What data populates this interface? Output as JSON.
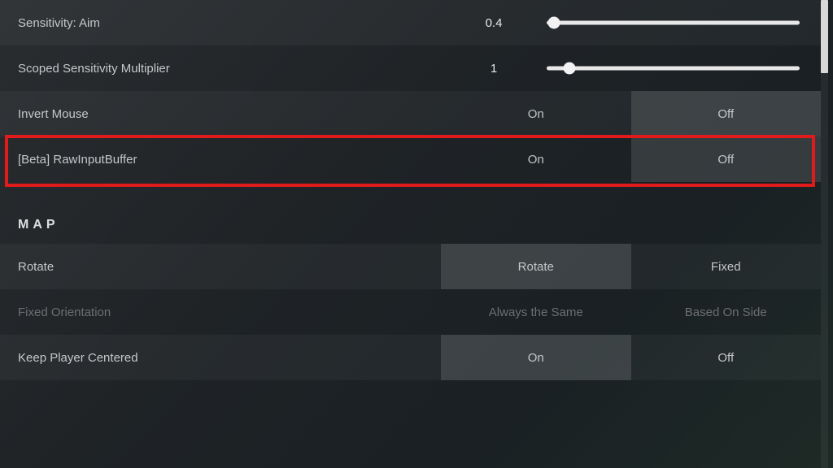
{
  "sensitivity": {
    "aim": {
      "label": "Sensitivity: Aim",
      "value": "0.4",
      "slider_pct": 3
    },
    "scoped": {
      "label": "Scoped Sensitivity Multiplier",
      "value": "1",
      "slider_pct": 9
    }
  },
  "toggles": {
    "invert_mouse": {
      "label": "Invert Mouse",
      "on": "On",
      "off": "Off",
      "selected": "off"
    },
    "raw_input_buffer": {
      "label": "[Beta] RawInputBuffer",
      "on": "On",
      "off": "Off",
      "selected": "off",
      "highlighted": true
    }
  },
  "section_map": {
    "header": "MAP"
  },
  "map": {
    "rotate": {
      "label": "Rotate",
      "opt_a": "Rotate",
      "opt_b": "Fixed",
      "selected": "a"
    },
    "fixed_orientation": {
      "label": "Fixed Orientation",
      "opt_a": "Always the Same",
      "opt_b": "Based On Side",
      "disabled": true
    },
    "keep_player_centered": {
      "label": "Keep Player Centered",
      "on": "On",
      "off": "Off",
      "selected": "on"
    }
  }
}
